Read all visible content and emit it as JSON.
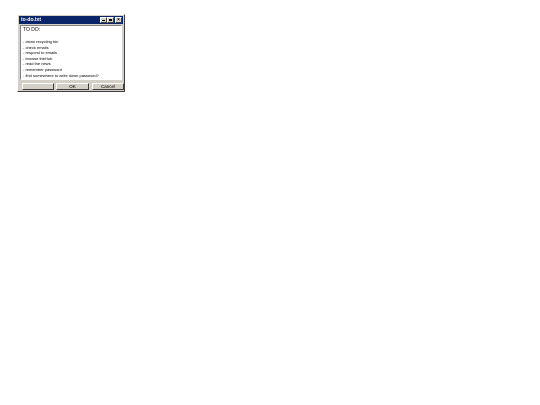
{
  "window": {
    "title": "to-do.txt"
  },
  "content": {
    "heading": "TO DO:",
    "items": [
      "- clean recycling bin",
      "- check emails",
      "- respond to emails",
      "- browse theHub",
      "- read the news",
      "- remember password",
      "- find somewhere to write down password?"
    ]
  },
  "buttons": {
    "first_label": "",
    "ok_label": "OK",
    "cancel_label": "Cancel"
  },
  "colors": {
    "titlebar": "#0a246a",
    "face": "#d4d0c8"
  },
  "icons": {
    "minimize": "minimize-icon",
    "maximize": "maximize-icon",
    "close": "close-icon"
  }
}
